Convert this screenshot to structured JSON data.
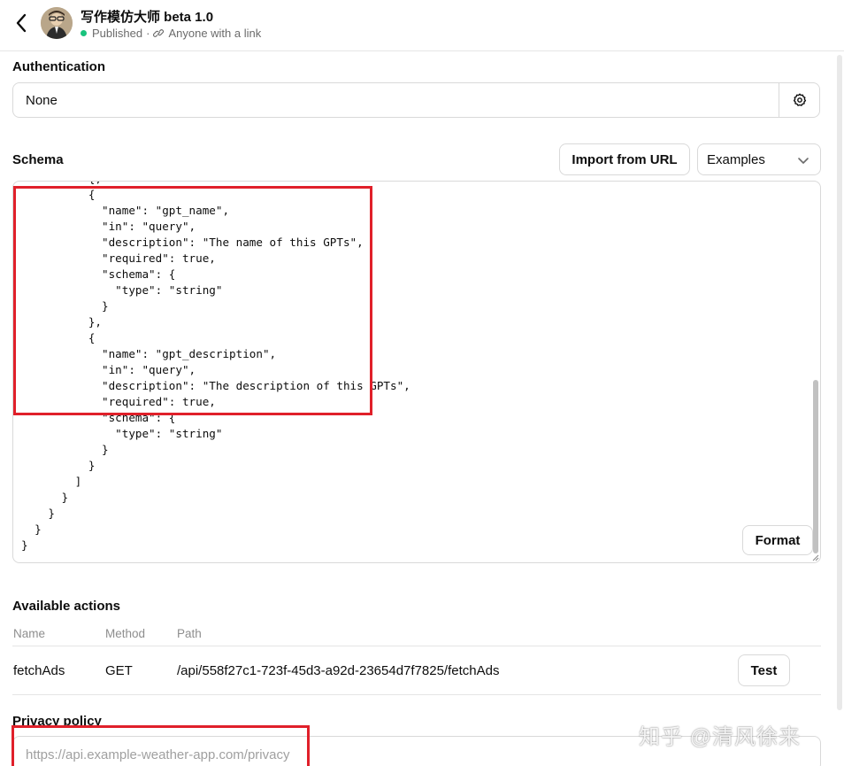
{
  "header": {
    "title": "写作模仿大师 beta 1.0",
    "status": "Published",
    "separator": "·",
    "visibility": "Anyone with a link"
  },
  "authentication": {
    "label": "Authentication",
    "value": "None"
  },
  "schema": {
    "label": "Schema",
    "import_button": "Import from URL",
    "examples_select": "Examples",
    "format_button": "Format",
    "code": "          {,\n          {\n            \"name\": \"gpt_name\",\n            \"in\": \"query\",\n            \"description\": \"The name of this GPTs\",\n            \"required\": true,\n            \"schema\": {\n              \"type\": \"string\"\n            }\n          },\n          {\n            \"name\": \"gpt_description\",\n            \"in\": \"query\",\n            \"description\": \"The description of this GPTs\",\n            \"required\": true,\n            \"schema\": {\n              \"type\": \"string\"\n            }\n          }\n        ]\n      }\n    }\n  }\n}"
  },
  "actions": {
    "label": "Available actions",
    "columns": [
      "Name",
      "Method",
      "Path"
    ],
    "rows": [
      {
        "name": "fetchAds",
        "method": "GET",
        "path": "/api/558f27c1-723f-45d3-a92d-23654d7f7825/fetchAds",
        "test_label": "Test"
      }
    ]
  },
  "privacy": {
    "label": "Privacy policy",
    "placeholder": "https://api.example-weather-app.com/privacy"
  },
  "watermark": "知乎 @清风徐来",
  "colors": {
    "highlight": "#e0202a",
    "published_dot": "#19c37d"
  }
}
